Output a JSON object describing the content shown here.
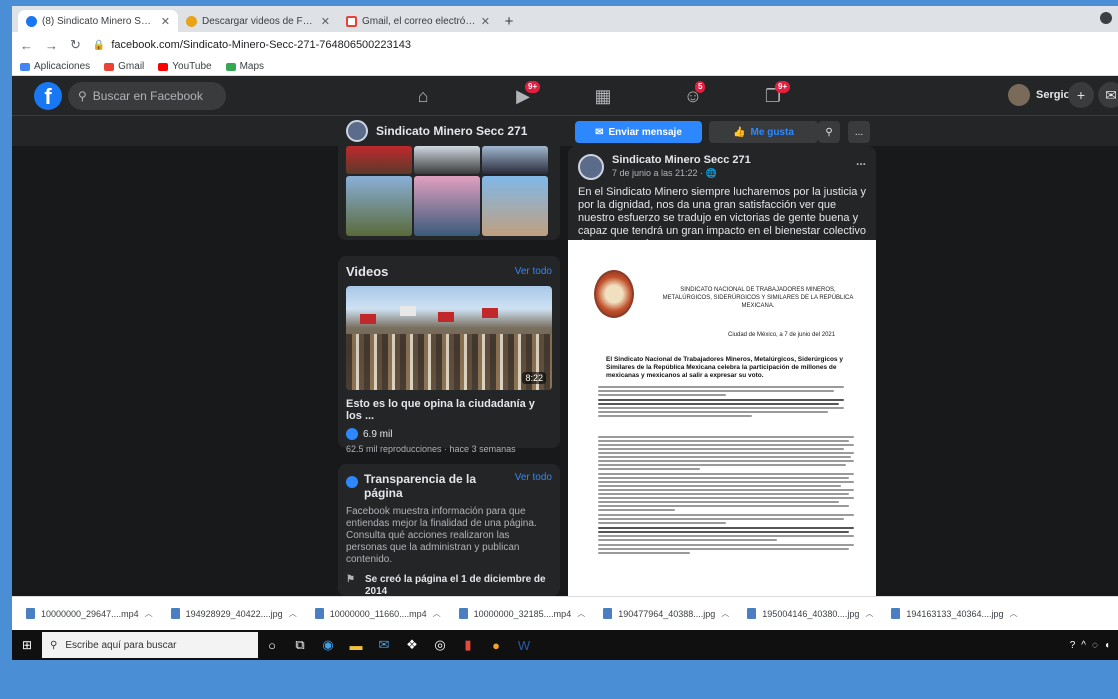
{
  "browser": {
    "tabs": [
      {
        "title": "(8) Sindicato Minero Secc 271 | F",
        "active": true
      },
      {
        "title": "Descargar videos de Facebook en",
        "active": false
      },
      {
        "title": "Gmail, el correo electrónico de G",
        "active": false
      }
    ],
    "new_tab": "+",
    "url": "facebook.com/Sindicato-Minero-Secc-271-764806500223143",
    "bookmarks": [
      "Aplicaciones",
      "Gmail",
      "YouTube",
      "Maps"
    ]
  },
  "fb": {
    "search_placeholder": "Buscar en Facebook",
    "badges": {
      "watch": "9+",
      "groups": "5",
      "notif": "9+"
    },
    "user_name": "Sergio",
    "add": "+"
  },
  "page_header": {
    "name": "Sindicato Minero Secc 271",
    "message_button": "Enviar mensaje",
    "like_button": "Me gusta",
    "more": "..."
  },
  "videos": {
    "title": "Videos",
    "see_all": "Ver todo",
    "duration": "8:22",
    "video_title": "Esto es lo que opina la ciudadanía y los ...",
    "likes": "6.9 mil",
    "meta": "62.5 mil reproducciones · hace 3 semanas"
  },
  "transparency": {
    "title": "Transparencia de la página",
    "see_all": "Ver todo",
    "body": "Facebook muestra información para que entiendas mejor la finalidad de una página. Consulta qué acciones realizaron las personas que la administran y publican contenido.",
    "created": "Se creó la página el 1 de diciembre de 2014"
  },
  "post": {
    "author": "Sindicato Minero Secc 271",
    "time": "7 de junio a las 21:22 ·",
    "more": "...",
    "text": "En el Sindicato Minero siempre lucharemos por la justicia y por la dignidad, nos da una gran satisfacción ver que nuestro esfuerzo se tradujo en victorias de gente buena y capaz que tendrá un gran impacto en el bienestar colectivo de nuestro país.",
    "doc_heading": "SINDICATO NACIONAL DE TRABAJADORES MINEROS, METALÚRGICOS, SIDERÚRGICOS Y SIMILARES DE LA REPÚBLICA MEXICANA.",
    "doc_date": "Ciudad de México, a 7 de junio del 2021",
    "doc_title": "El Sindicato Nacional de Trabajadores Mineros, Metalúrgicos, Siderúrgicos y Similares de la República Mexicana celebra la participación de millones de mexicanas y mexicanos al salir a expresar su voto."
  },
  "downloads": [
    "10000000_29647....mp4",
    "194928929_40422....jpg",
    "10000000_11660....mp4",
    "10000000_32185....mp4",
    "190477964_40388....jpg",
    "195004146_40380....jpg",
    "194163133_40364....jpg"
  ],
  "taskbar": {
    "search_placeholder": "Escribe aquí para buscar"
  }
}
